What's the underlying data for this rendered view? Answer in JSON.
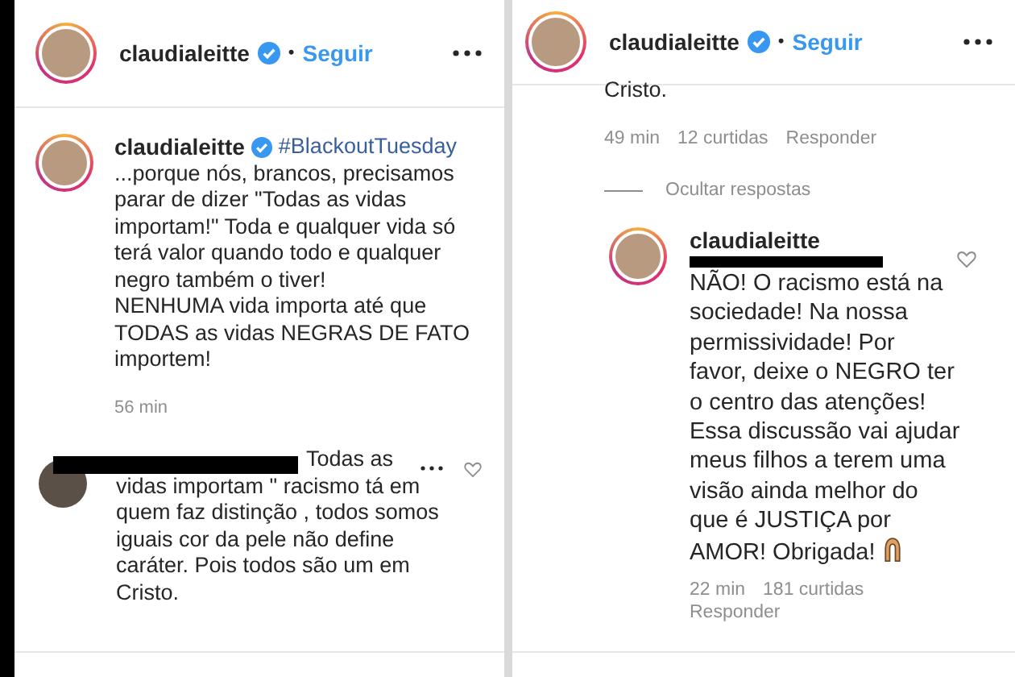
{
  "left_panel": {
    "header": {
      "username": "claudialeitte",
      "verified": true,
      "separator": "•",
      "follow": "Seguir"
    },
    "caption": {
      "username": "claudialeitte",
      "verified": true,
      "hashtag": "#BlackoutTuesday",
      "lines": [
        "...porque nós, brancos, precisamos",
        "parar de dizer \"Todas as vidas",
        "importam!\" Toda e qualquer vida só",
        "terá valor quando todo e qualquer",
        "negro também o tiver!",
        "NENHUMA vida importa até que",
        "TODAS as vidas NEGRAS DE FATO",
        "importem!"
      ],
      "time": "56 min"
    },
    "comment": {
      "first_line": "Todas as",
      "lines": [
        "vidas importam \" racismo tá em",
        "quem faz distinção , todos somos",
        "iguais cor da pele não define",
        "caráter. Pois todos são um em",
        "Cristo."
      ]
    }
  },
  "right_panel": {
    "header": {
      "username": "claudialeitte",
      "verified": true,
      "separator": "•",
      "follow": "Seguir"
    },
    "previous_comment_tail": "Cristo.",
    "comment_meta": {
      "time": "49 min",
      "likes": "12 curtidas",
      "reply": "Responder"
    },
    "hide_replies": "Ocultar respostas",
    "reply": {
      "username": "claudialeitte",
      "verified": false,
      "lines": [
        "NÃO! O racismo está na",
        "sociedade! Na nossa",
        "permissividade! Por",
        "favor, deixe o NEGRO ter",
        "o centro das atenções!",
        "Essa discussão vai ajudar",
        "meus filhos a terem uma",
        "visão ainda melhor do",
        "que é JUSTIÇA por",
        "AMOR! Obrigada!"
      ],
      "time": "22 min",
      "likes": "181 curtidas",
      "reply": "Responder"
    }
  }
}
